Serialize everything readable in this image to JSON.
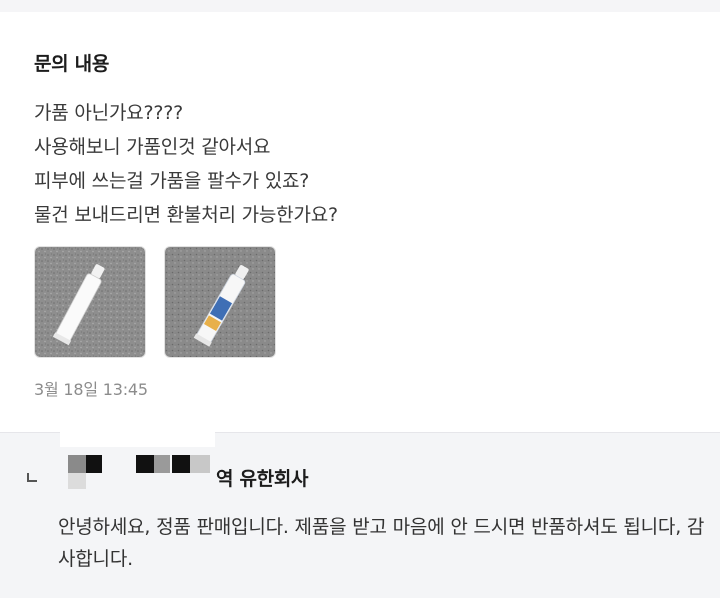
{
  "inquiry": {
    "section_title": "문의 내용",
    "question_lines": [
      "가품 아닌가요????",
      "사용해보니 가품인것 같아서요",
      "피부에 쓰는걸 가품을 팔수가 있죠?",
      "물건 보내드리면 환불처리 가능한가요?"
    ],
    "photos": [
      {
        "name": "photo-white-tube-thumbnail",
        "description": ""
      },
      {
        "name": "photo-blue-tube-thumbnail",
        "description": ""
      }
    ],
    "date": "3월 18일 13:45"
  },
  "reply": {
    "seller_name_visible": "역 유한회사",
    "answer": "안녕하세요, 정품 판매입니다. 제품을 받고 마음에 안 드시면 반품하셔도 됩니다, 감사합니다."
  },
  "colors": {
    "background": "#ffffff",
    "reply_background": "#f4f5f7",
    "text_primary": "#1c1c1c",
    "text_body": "#3a3a3a",
    "text_muted": "#8c8c8c"
  },
  "icons": [
    "reply-indent-icon"
  ]
}
